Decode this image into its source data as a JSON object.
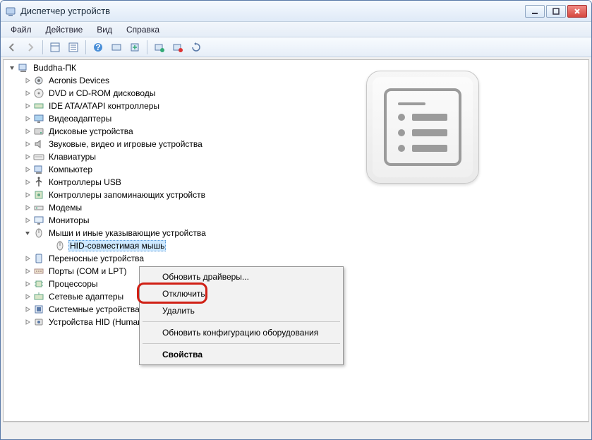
{
  "window": {
    "title": "Диспетчер устройств"
  },
  "menubar": {
    "items": [
      "Файл",
      "Действие",
      "Вид",
      "Справка"
    ]
  },
  "tree": {
    "root": "Buddha-ПК",
    "nodes": [
      {
        "label": "Acronis Devices",
        "icon": "gear"
      },
      {
        "label": "DVD и CD-ROM дисководы",
        "icon": "disc"
      },
      {
        "label": "IDE ATA/ATAPI контроллеры",
        "icon": "ide"
      },
      {
        "label": "Видеоадаптеры",
        "icon": "display"
      },
      {
        "label": "Дисковые устройства",
        "icon": "drive"
      },
      {
        "label": "Звуковые, видео и игровые устройства",
        "icon": "sound"
      },
      {
        "label": "Клавиатуры",
        "icon": "keyboard"
      },
      {
        "label": "Компьютер",
        "icon": "computer"
      },
      {
        "label": "Контроллеры USB",
        "icon": "usb"
      },
      {
        "label": "Контроллеры запоминающих устройств",
        "icon": "storage"
      },
      {
        "label": "Модемы",
        "icon": "modem"
      },
      {
        "label": "Мониторы",
        "icon": "monitor"
      },
      {
        "label": "Мыши и иные указывающие устройства",
        "icon": "mouse",
        "expanded": true,
        "children": [
          {
            "label": "HID-совместимая мышь",
            "icon": "mouse",
            "selected": true
          }
        ]
      },
      {
        "label": "Переносные устройства",
        "icon": "portable"
      },
      {
        "label": "Порты (COM и LPT)",
        "icon": "port"
      },
      {
        "label": "Процессоры",
        "icon": "cpu"
      },
      {
        "label": "Сетевые адаптеры",
        "icon": "network"
      },
      {
        "label": "Системные устройства",
        "icon": "system"
      },
      {
        "label": "Устройства HID (Human Interface Devices)",
        "icon": "hid"
      }
    ]
  },
  "contextmenu": {
    "items": [
      {
        "label": "Обновить драйверы..."
      },
      {
        "label": "Отключить",
        "highlighted": true
      },
      {
        "label": "Удалить"
      },
      {
        "sep": true
      },
      {
        "label": "Обновить конфигурацию оборудования"
      },
      {
        "sep": true
      },
      {
        "label": "Свойства",
        "bold": true
      }
    ]
  }
}
